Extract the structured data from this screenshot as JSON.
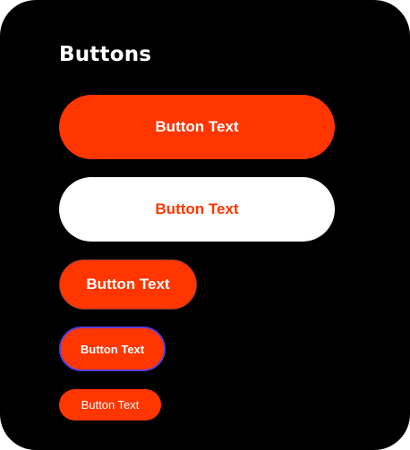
{
  "panel": {
    "title": "Buttons"
  },
  "buttons": {
    "xl_primary": "Button Text",
    "xl_secondary": "Button Text",
    "large": "Button Text",
    "medium_focused": "Button Text",
    "small": "Button Text"
  },
  "colors": {
    "background": "#000000",
    "accent": "#ff3600",
    "text_on_accent": "#ffffff",
    "secondary_fill": "#ffffff",
    "focus_ring": "#5a3fd6"
  }
}
